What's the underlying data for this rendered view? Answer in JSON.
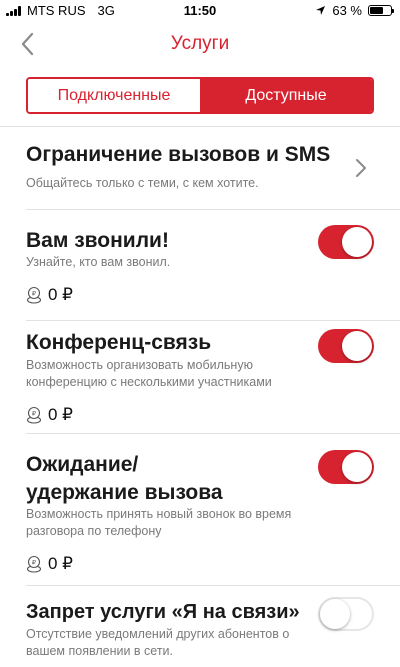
{
  "status_bar": {
    "carrier": "MTS RUS",
    "network": "3G",
    "time": "11:50",
    "battery": "63 %",
    "battery_level": 0.63
  },
  "nav": {
    "title": "Услуги"
  },
  "tabs": [
    {
      "label": "Подключенные",
      "active": false
    },
    {
      "label": "Доступные",
      "active": true
    }
  ],
  "services": [
    {
      "title": "Ограничение вызовов и SMS",
      "description": "Общайтесь только с теми, с кем хотите.",
      "control": "chevron"
    },
    {
      "title": "Вам звонили!",
      "description": "Узнайте, кто вам звонил.",
      "price": "0 ₽",
      "enabled": true
    },
    {
      "title": "Конференц-связь",
      "description_lines": [
        "Возможность организовать мобильную",
        "конференцию с несколькими участниками"
      ],
      "price": "0 ₽",
      "enabled": true
    },
    {
      "title_lines": [
        "Ожидание/",
        "удержание вызова"
      ],
      "description_lines": [
        "Возможность принять новый звонок во время",
        "разговора по телефону"
      ],
      "price": "0 ₽",
      "enabled": true
    },
    {
      "title": "Запрет услуги «Я на связи»",
      "description_lines": [
        "Отсутствие уведомлений других абонентов о",
        "вашем появлении в сети."
      ],
      "enabled": false
    }
  ],
  "colors": {
    "accent": "#d7232f",
    "text": "#1a1a1a",
    "secondary_text": "#7a7a7a"
  }
}
